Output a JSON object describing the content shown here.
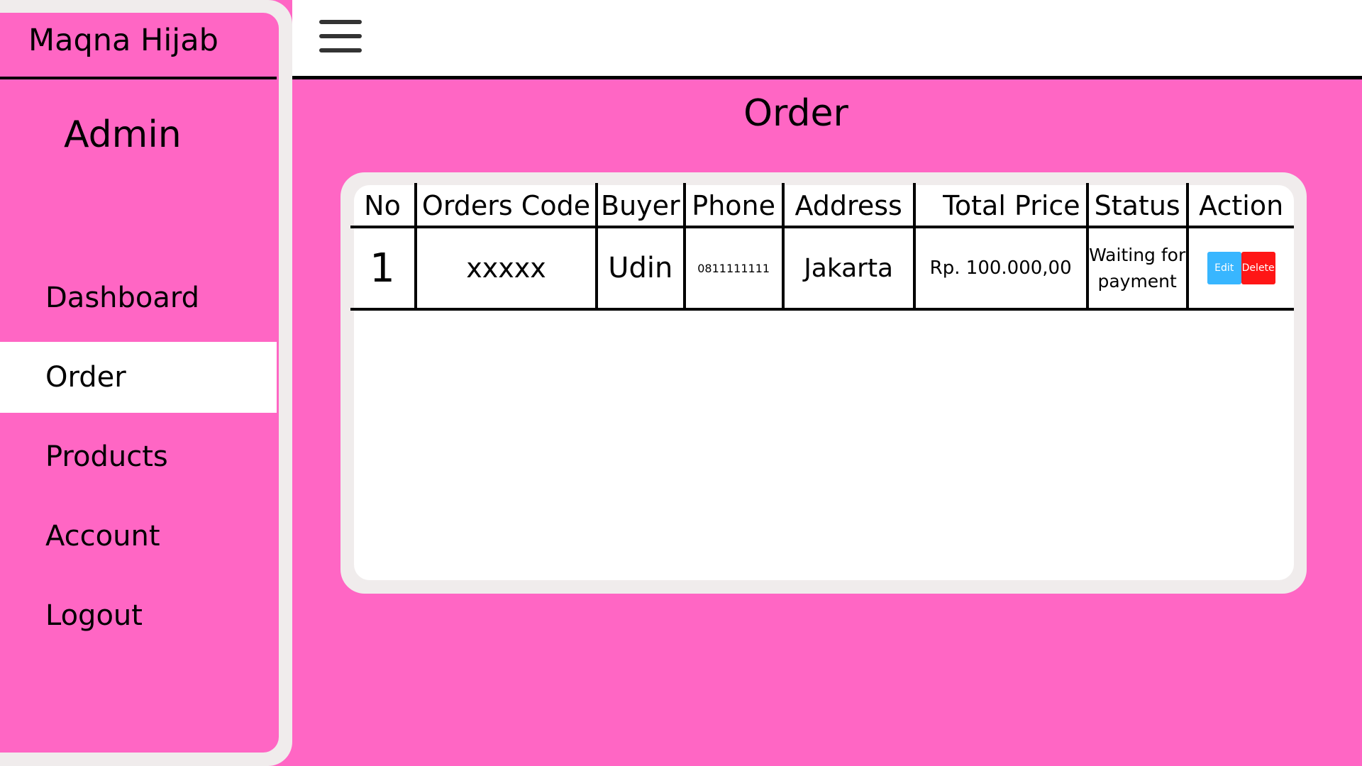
{
  "sidebar": {
    "brand": "Maqna Hijab",
    "role": "Admin",
    "items": [
      {
        "label": "Dashboard"
      },
      {
        "label": "Order"
      },
      {
        "label": "Products"
      },
      {
        "label": "Account"
      },
      {
        "label": "Logout"
      }
    ],
    "active": "Order"
  },
  "header": {
    "menu_icon": "hamburger-menu-icon"
  },
  "main": {
    "title": "Order",
    "table": {
      "columns": [
        "No",
        "Orders Code",
        "Buyer",
        "Phone",
        "Address",
        "Total Price",
        "Status",
        "Action"
      ],
      "rows": [
        {
          "no": "1",
          "code": "xxxxx",
          "buyer": "Udin",
          "phone": "0811111111",
          "address": "Jakarta",
          "total": "Rp. 100.000,00",
          "status": "Waiting for payment",
          "edit_label": "Edit",
          "delete_label": "Delete"
        }
      ]
    }
  },
  "colors": {
    "background": "#ff66c4",
    "frame": "#f0ecec",
    "edit": "#38b6ff",
    "delete": "#ff1616"
  }
}
